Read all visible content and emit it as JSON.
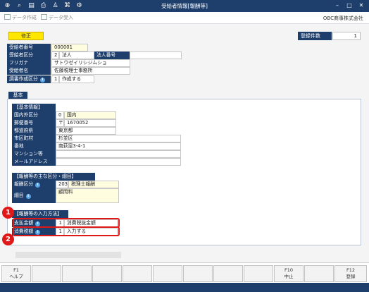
{
  "window": {
    "title": "受給者情報[報酬等]"
  },
  "toolbar": {
    "create_label": "データ作成",
    "import_label": "データ受入",
    "company": "OBC商事株式会社"
  },
  "actions": {
    "edit_label": "修正"
  },
  "count": {
    "label": "登録件数",
    "value": "1"
  },
  "recipient": {
    "number_label": "受給者番号",
    "number_value": "000001",
    "type_label": "受給者区分",
    "type_code": "2",
    "type_name": "法人",
    "corp_no_label": "法人番号",
    "corp_no_value": "",
    "kana_label": "フリガナ",
    "kana_value": "サトウゼイリシジムショ",
    "name_label": "受給者名",
    "name_value": "佐藤税理士事務所",
    "report_label": "調書作成区分",
    "report_code": "1",
    "report_name": "作成する"
  },
  "tab": {
    "label": "基本"
  },
  "basic": {
    "header": "【基本情報】",
    "domestic_label": "国内外区分",
    "domestic_code": "0",
    "domestic_name": "国内",
    "zip_label": "郵便番号",
    "zip_mark": "〒",
    "zip_value": "1670052",
    "pref_label": "都道府県",
    "pref_value": "東京都",
    "city_label": "市区町村",
    "city_value": "杉並区",
    "addr_label": "番地",
    "addr_value": "南荻窪3-4-1",
    "bldg_label": "マンション等",
    "bldg_value": "",
    "mail_label": "メールアドレス",
    "mail_value": ""
  },
  "rewards": {
    "header": "【報酬等の主な区分・細目】",
    "kubun_label": "報酬区分",
    "kubun_code": "203",
    "kubun_name": "税理士報酬",
    "detail_label": "細目",
    "detail_value": "顧問料"
  },
  "input_method": {
    "header": "【報酬等の入力方法】",
    "payment_label": "支払金額",
    "payment_code": "1",
    "payment_name": "消費税抜金額",
    "tax_label": "消費税額",
    "tax_code": "1",
    "tax_name": "入力する"
  },
  "markers": {
    "one": "1",
    "two": "2"
  },
  "fkeys": {
    "f1_key": "F1",
    "f1_label": "ヘルプ",
    "f10_key": "F10",
    "f10_label": "中止",
    "f12_key": "F12",
    "f12_label": "登録"
  },
  "colors": {
    "navy": "#1e3f6c",
    "edit_yellow": "#ffe600",
    "highlight_red": "#e01818"
  }
}
